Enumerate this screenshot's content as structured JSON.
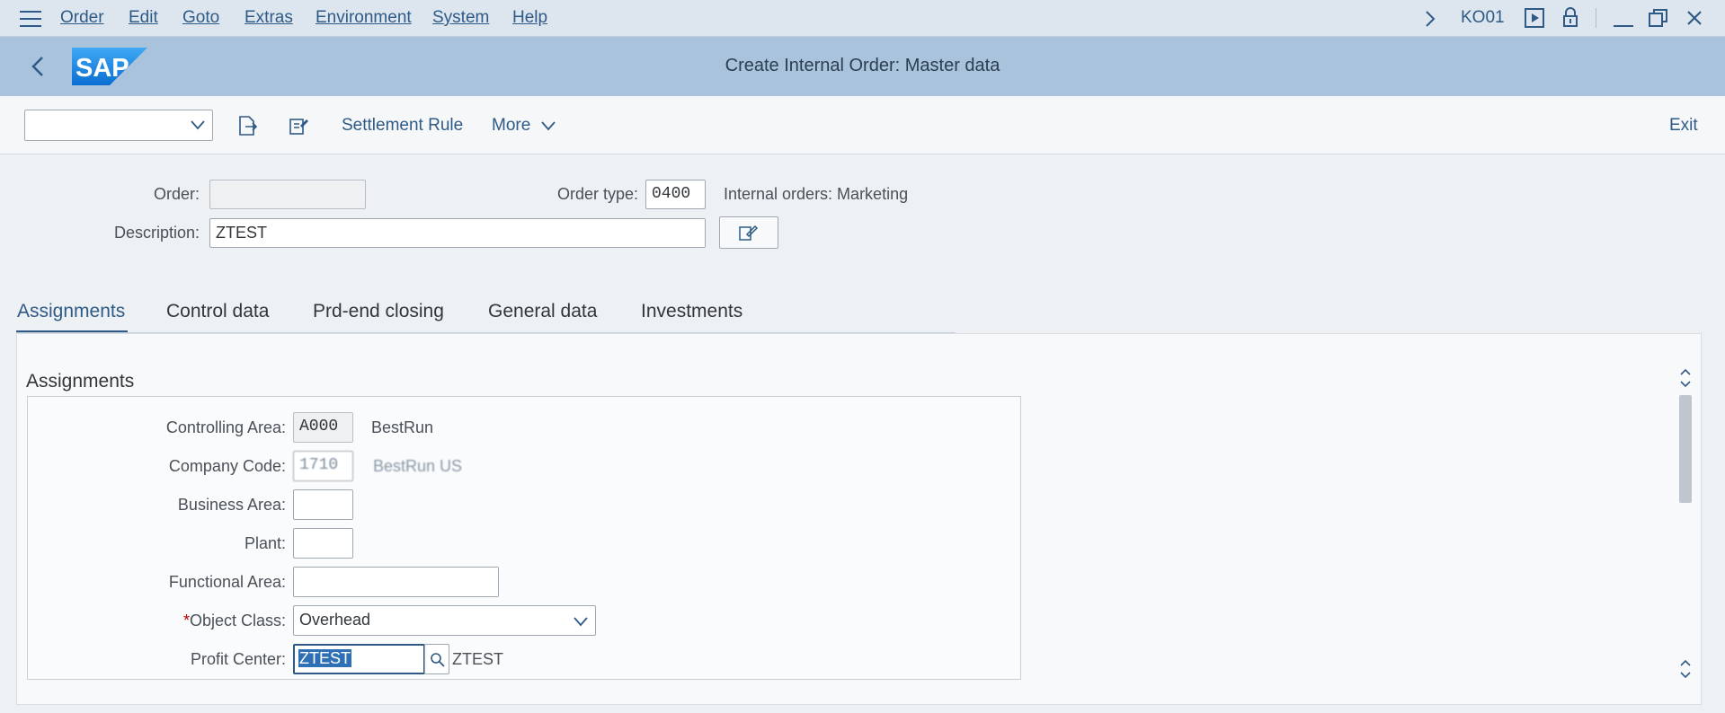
{
  "menu": {
    "items": [
      "Order",
      "Edit",
      "Goto",
      "Extras",
      "Environment",
      "System",
      "Help"
    ],
    "transaction": "KO01"
  },
  "title": "Create Internal Order: Master data",
  "toolbar": {
    "dropdown_value": "",
    "settlement_rule": "Settlement Rule",
    "more": "More",
    "exit": "Exit"
  },
  "header": {
    "order_label": "Order:",
    "order_value": "",
    "order_type_label": "Order type:",
    "order_type_value": "0400",
    "order_type_desc": "Internal orders: Marketing",
    "description_label": "Description:",
    "description_value": "ZTEST"
  },
  "tabs": [
    "Assignments",
    "Control data",
    "Prd-end closing",
    "General data",
    "Investments"
  ],
  "active_tab": "Assignments",
  "assignments": {
    "section_title": "Assignments",
    "controlling_area_label": "Controlling Area:",
    "controlling_area_value": "A000",
    "controlling_area_desc": "BestRun",
    "company_code_label": "Company Code:",
    "company_code_value": "1710",
    "company_code_desc": "BestRun US",
    "business_area_label": "Business Area:",
    "business_area_value": "",
    "plant_label": "Plant:",
    "plant_value": "",
    "functional_area_label": "Functional Area:",
    "functional_area_value": "",
    "object_class_label": "Object Class:",
    "object_class_value": "Overhead",
    "profit_center_label": "Profit Center:",
    "profit_center_value": "ZTEST",
    "profit_center_desc": "ZTEST"
  },
  "colors": {
    "accent": "#2f5a86",
    "titlebar": "#a9c3dc",
    "menubar": "#dde6ef"
  }
}
